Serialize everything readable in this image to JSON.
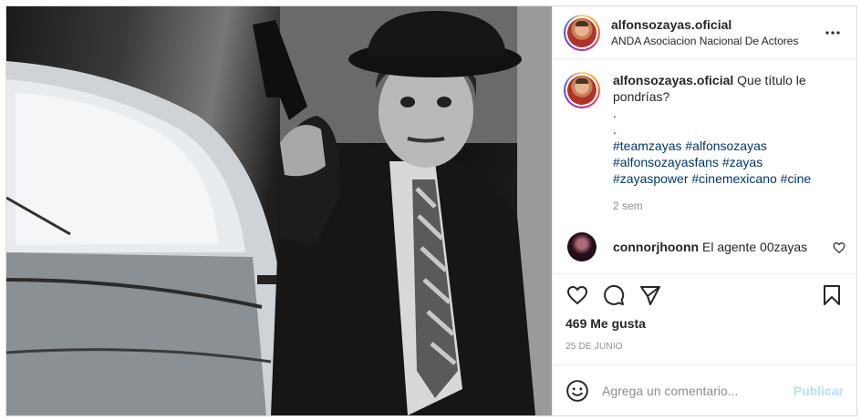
{
  "post": {
    "image_alt": "Fotografía en blanco y negro de un hombre con sombrero apuntando una pistola junto a un automóvil antiguo"
  },
  "header": {
    "username": "alfonsozayas.oficial",
    "location": "ANDA Asociacion Nacional De Actores",
    "more_icon": "more-horizontal-icon"
  },
  "caption": {
    "author": "alfonsozayas.oficial",
    "text": "Que título le pondrías?",
    "dot_line_1": ".",
    "dot_line_2": ".",
    "hashtags": [
      "#teamzayas",
      "#alfonsozayas",
      "#alfonsozayasfans",
      "#zayas",
      "#zayaspower",
      "#cinemexicano",
      "#cine"
    ],
    "time_ago": "2 sem"
  },
  "comments": [
    {
      "author": "connorjhoonn",
      "text": "El agente 00zayas"
    }
  ],
  "actions": {
    "like_icon": "heart-icon",
    "comment_icon": "comment-icon",
    "share_icon": "paper-plane-icon",
    "save_icon": "bookmark-icon"
  },
  "likes": "469 Me gusta",
  "date": "25 DE JUNIO",
  "add_comment": {
    "placeholder": "Agrega un comentario...",
    "post_label": "Publicar",
    "emoji_icon": "smiley-icon"
  },
  "colors": {
    "text": "#262626",
    "muted": "#8e8e8e",
    "hashtag": "#00376b",
    "post_button_disabled": "#b2dffc",
    "border": "#dbdbdb"
  }
}
